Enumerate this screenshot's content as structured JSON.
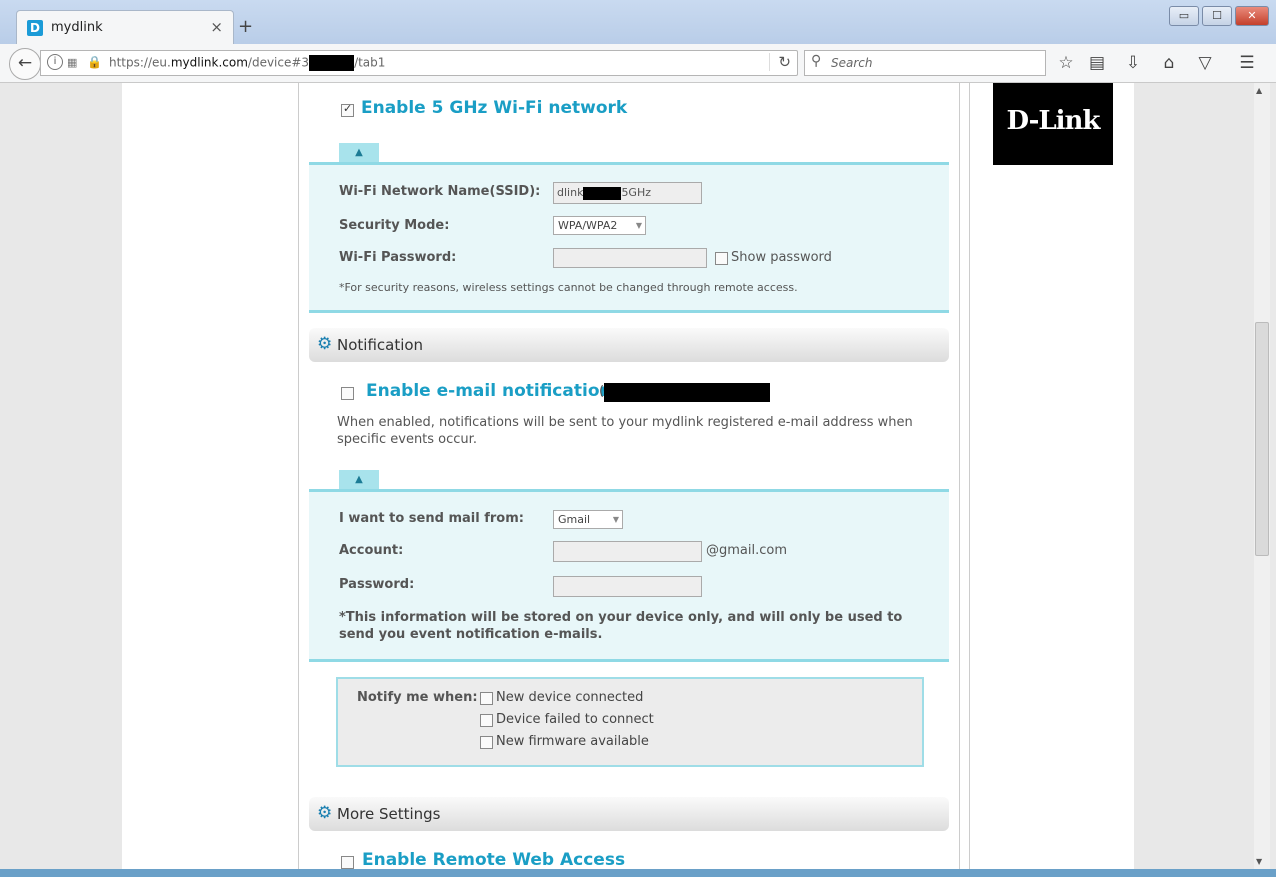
{
  "browser": {
    "tab_title": "mydlink",
    "tab_close": "×",
    "new_tab": "+",
    "url_prefix": "https://eu.",
    "url_domain": "mydlink.com",
    "url_path": "/device#3",
    "url_suffix": "/tab1",
    "search_placeholder": "Search",
    "window_buttons": {
      "minimize": "▭",
      "maximize": "☐",
      "close": "✕"
    }
  },
  "logo": {
    "text": "D-Link"
  },
  "wifi5": {
    "heading": "Enable 5 GHz Wi-Fi network",
    "checked": true,
    "ssid_label": "Wi-Fi Network Name(SSID):",
    "ssid_prefix": "dlink",
    "ssid_suffix": "5GHz",
    "security_label": "Security Mode:",
    "security_value": "WPA/WPA2",
    "password_label": "Wi-Fi Password:",
    "show_password_label": "Show password",
    "note": "*For security reasons, wireless settings cannot be changed through remote access."
  },
  "notification": {
    "section_title": "Notification",
    "email_heading": "Enable e-mail notifications",
    "email_paren": "(",
    "description": "When enabled, notifications will be sent to your mydlink registered e-mail address when specific events occur.",
    "send_from_label": "I want to send mail from:",
    "send_from_value": "Gmail",
    "account_label": "Account:",
    "account_suffix": "@gmail.com",
    "password_label": "Password:",
    "storage_note": "*This information will be stored on your device only, and will only be used to send you event notification e-mails.",
    "notify_label": "Notify me when:",
    "notify_options": [
      "New device connected",
      "Device failed to connect",
      "New firmware available"
    ]
  },
  "more_settings": {
    "section_title": "More Settings",
    "remote_heading": "Enable Remote Web Access"
  }
}
